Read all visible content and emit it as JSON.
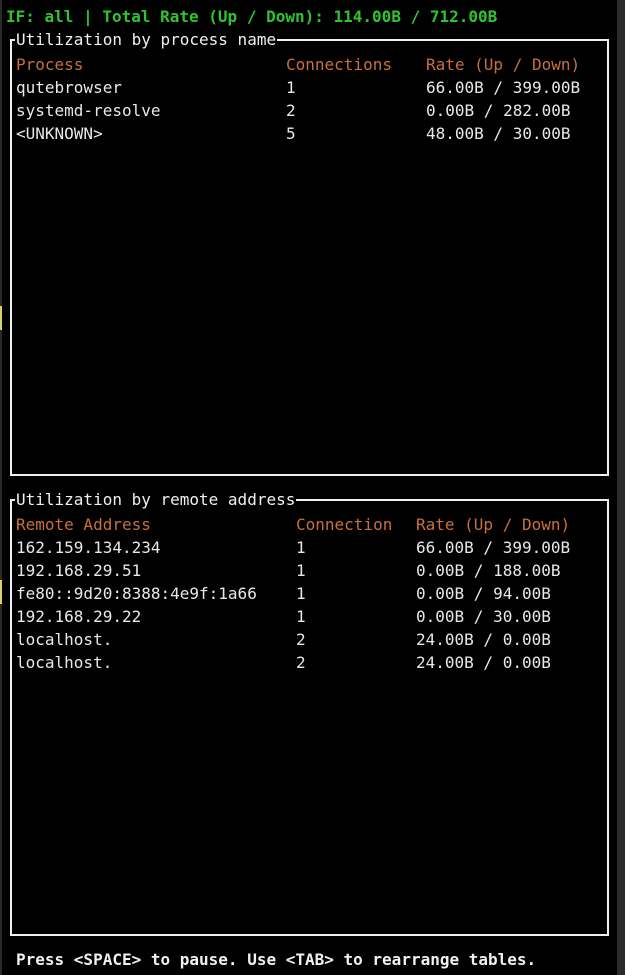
{
  "status_bar": {
    "text": "IF: all | Total Rate (Up / Down): 114.00B / 712.00B"
  },
  "process_table": {
    "title": "Utilization by process name",
    "headers": [
      "Process",
      "Connections",
      "Rate (Up / Down)"
    ],
    "rows": [
      [
        "qutebrowser",
        "1",
        "66.00B / 399.00B"
      ],
      [
        "systemd-resolve",
        "2",
        "0.00B / 282.00B"
      ],
      [
        "<UNKNOWN>",
        "5",
        "48.00B / 30.00B"
      ]
    ]
  },
  "remote_table": {
    "title": "Utilization by remote address",
    "headers": [
      "Remote Address",
      "Connection",
      "Rate (Up / Down)"
    ],
    "rows": [
      [
        "162.159.134.234",
        "1",
        "66.00B / 399.00B"
      ],
      [
        "192.168.29.51",
        "1",
        "0.00B / 188.00B"
      ],
      [
        "fe80::9d20:8388:4e9f:1a66",
        "1",
        "0.00B / 94.00B"
      ],
      [
        "192.168.29.22",
        "1",
        "0.00B / 30.00B"
      ],
      [
        "localhost.",
        "2",
        "24.00B / 0.00B"
      ],
      [
        "localhost.",
        "2",
        "24.00B / 0.00B"
      ]
    ]
  },
  "footer": {
    "hint": "Press <SPACE> to pause. Use <TAB> to rearrange tables."
  },
  "colors": {
    "background": "#000000",
    "status_green": "#2fc42f",
    "header_orange": "#c8703a",
    "border": "#f0f0f0",
    "text": "#e8e8e8"
  }
}
